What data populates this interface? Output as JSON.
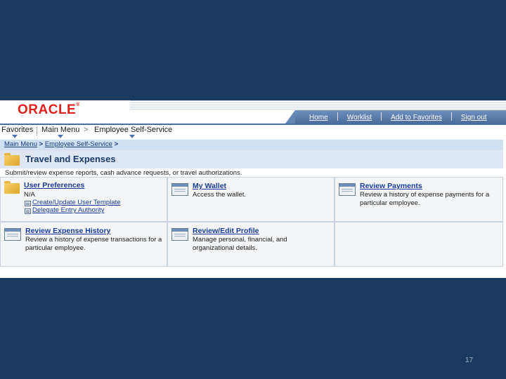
{
  "brand": {
    "logo_text": "ORACLE"
  },
  "top_links": [
    "Home",
    "Worklist",
    "Add to Favorites",
    "Sign out"
  ],
  "menu": {
    "favorites": "Favorites",
    "main_menu": "Main Menu",
    "employee_self_service": "Employee Self-Service",
    "chevron": ">"
  },
  "breadcrumb": {
    "main_menu": "Main Menu",
    "sep1": " > ",
    "employee_self_service": "Employee Self-Service",
    "sep2": " >"
  },
  "page": {
    "title": "Travel and Expenses",
    "description": "Submit/review expense reports, cash advance requests, or travel authorizations."
  },
  "tiles": {
    "user_preferences": {
      "title": "User Preferences",
      "desc": "N/A",
      "links": [
        "Create/Update User Template",
        "Delegate Entry Authority"
      ]
    },
    "my_wallet": {
      "title": "My Wallet",
      "desc": "Access the wallet."
    },
    "review_payments": {
      "title": "Review Payments",
      "desc": "Review a history of expense payments for a particular employee."
    },
    "review_expense_history": {
      "title": "Review Expense History",
      "desc": "Review a history of expense transactions for a particular employee."
    },
    "review_edit_profile": {
      "title": "Review/Edit Profile",
      "desc": "Manage personal, financial, and organizational details."
    }
  },
  "slide": {
    "page_number": "17"
  },
  "colors": {
    "slide_bg": "#1a3a60",
    "logo_red": "#e0201c",
    "link_blue": "#1a3a9a",
    "header_bar": "#4a6d9c"
  }
}
